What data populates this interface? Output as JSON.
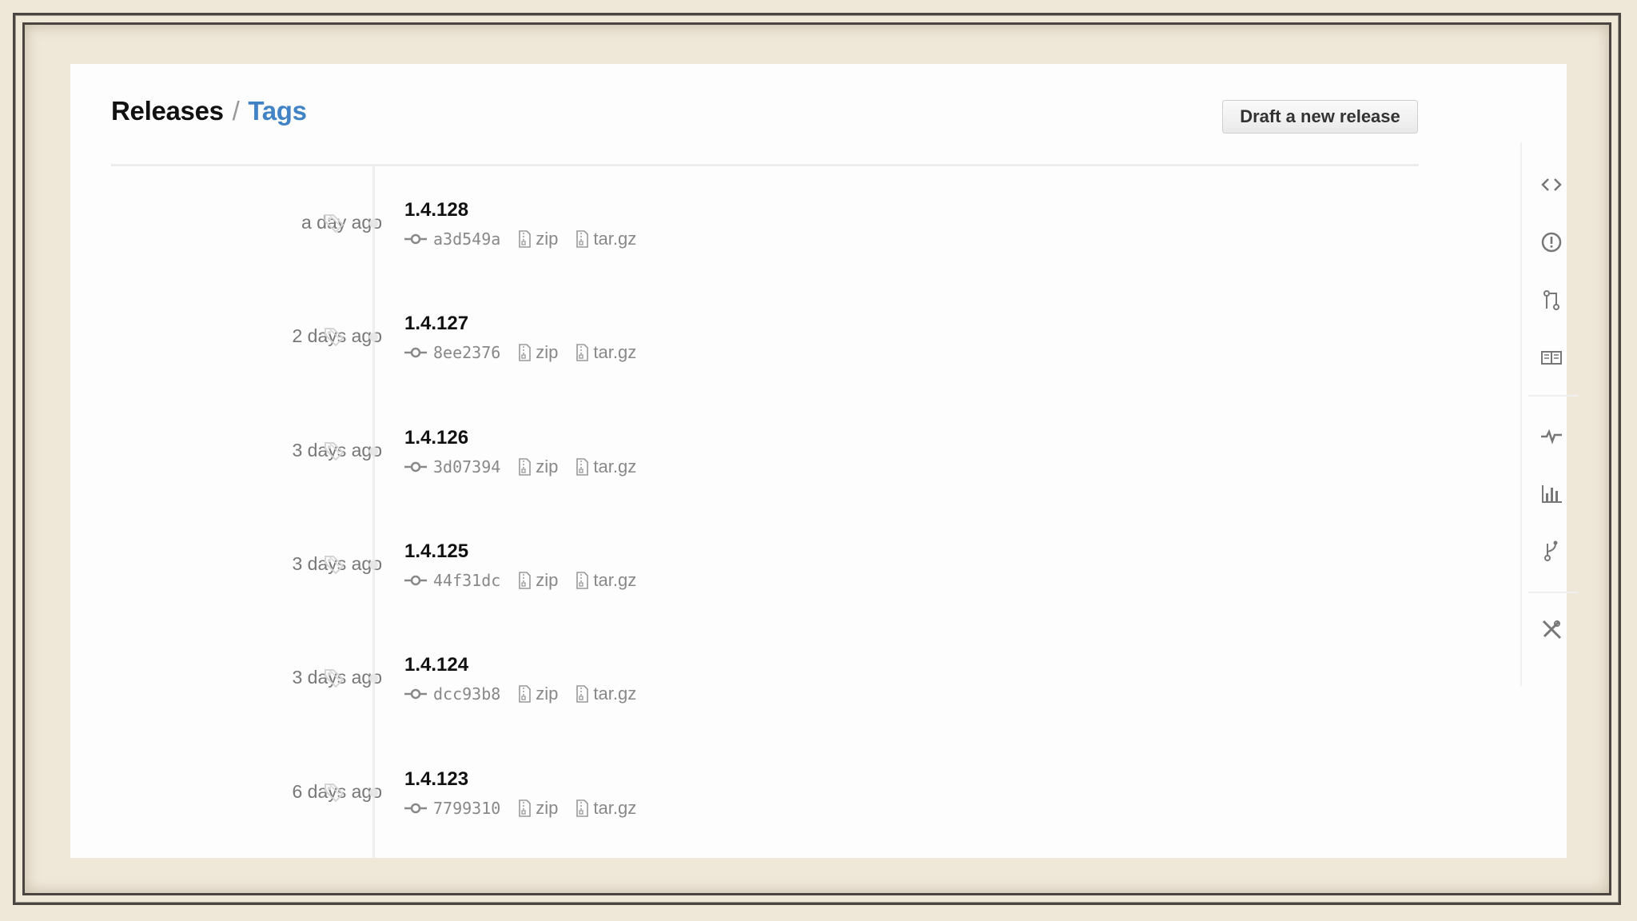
{
  "header": {
    "title_releases": "Releases",
    "separator": "/",
    "title_tags": "Tags",
    "draft_button": "Draft a new release"
  },
  "colors": {
    "accent": "#4183c4",
    "text": "#111111",
    "muted": "#888888",
    "frame_background": "#efe7d8"
  },
  "releases": [
    {
      "date": "a day ago",
      "version": "1.4.128",
      "sha": "a3d549a",
      "zip": "zip",
      "targz": "tar.gz"
    },
    {
      "date": "2 days ago",
      "version": "1.4.127",
      "sha": "8ee2376",
      "zip": "zip",
      "targz": "tar.gz"
    },
    {
      "date": "3 days ago",
      "version": "1.4.126",
      "sha": "3d07394",
      "zip": "zip",
      "targz": "tar.gz"
    },
    {
      "date": "3 days ago",
      "version": "1.4.125",
      "sha": "44f31dc",
      "zip": "zip",
      "targz": "tar.gz"
    },
    {
      "date": "3 days ago",
      "version": "1.4.124",
      "sha": "dcc93b8",
      "zip": "zip",
      "targz": "tar.gz"
    },
    {
      "date": "6 days ago",
      "version": "1.4.123",
      "sha": "7799310",
      "zip": "zip",
      "targz": "tar.gz"
    }
  ],
  "sidebar_icons": [
    "code-icon",
    "issues-icon",
    "pull-request-icon",
    "wiki-icon",
    "pulse-icon",
    "graphs-icon",
    "network-icon",
    "settings-icon"
  ]
}
